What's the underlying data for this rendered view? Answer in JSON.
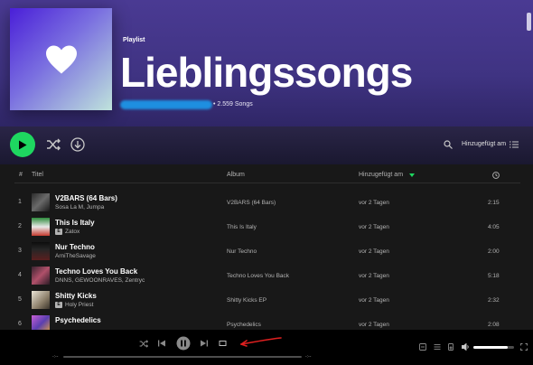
{
  "playlist": {
    "type_label": "Playlist",
    "title": "Lieblingssongs",
    "song_count": "• 2.559 Songs"
  },
  "toolbar": {
    "sort_label": "Hinzugefügt am"
  },
  "columns": {
    "number": "#",
    "title": "Titel",
    "album": "Album",
    "added": "Hinzugefügt am"
  },
  "tracks": [
    {
      "num": "1",
      "title": "V2BARS (64 Bars)",
      "artist": "Sosa La M, Jumpa",
      "explicit": false,
      "album": "V2BARS (64 Bars)",
      "added": "vor 2 Tagen",
      "duration": "2:15"
    },
    {
      "num": "2",
      "title": "This Is Italy",
      "artist": "Zatox",
      "explicit": true,
      "album": "This Is Italy",
      "added": "vor 2 Tagen",
      "duration": "4:05"
    },
    {
      "num": "3",
      "title": "Nur Techno",
      "artist": "ArniTheSavage",
      "explicit": false,
      "album": "Nur Techno",
      "added": "vor 2 Tagen",
      "duration": "2:00"
    },
    {
      "num": "4",
      "title": "Techno Loves You Back",
      "artist": "DNNS, GEWOONRAVES, Zentryc",
      "explicit": false,
      "album": "Techno Loves You Back",
      "added": "vor 2 Tagen",
      "duration": "5:18"
    },
    {
      "num": "5",
      "title": "Shitty Kicks",
      "artist": "Holy Priest",
      "explicit": true,
      "album": "Shitty Kicks EP",
      "added": "vor 2 Tagen",
      "duration": "2:32"
    },
    {
      "num": "6",
      "title": "Psychedelics",
      "artist": "",
      "explicit": false,
      "album": "Psychedelics",
      "added": "vor 2 Tagen",
      "duration": "2:08"
    }
  ],
  "player": {
    "elapsed": "-:--",
    "total": "-:--",
    "volume_level": 0.85
  },
  "colors": {
    "accent": "#1ed760",
    "header_bg": "#4a3a93",
    "annotation": "#e02020",
    "blur_mark": "#1e8fe0"
  },
  "icons": [
    "heart-icon",
    "play-icon",
    "shuffle-icon",
    "download-icon",
    "search-icon",
    "list-view-icon",
    "clock-icon",
    "sort-down-icon",
    "previous-icon",
    "pause-icon",
    "next-icon",
    "repeat-icon",
    "queue-icon",
    "devices-icon",
    "volume-icon",
    "fullscreen-icon",
    "lyrics-icon"
  ]
}
